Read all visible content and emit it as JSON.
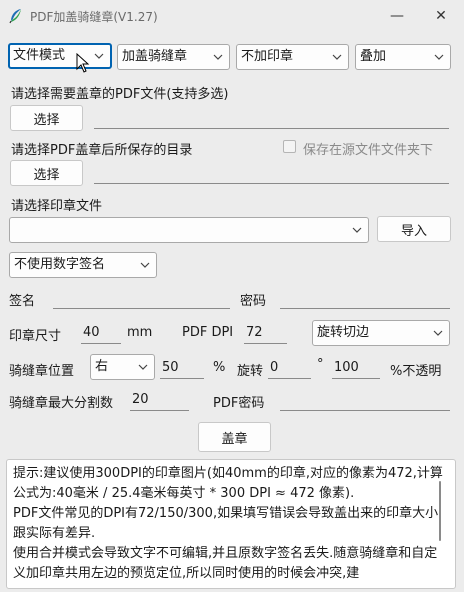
{
  "window": {
    "title": "PDF加盖骑缝章(V1.27)",
    "minimize": "—",
    "close": "✕",
    "app_icon": "feather-icon"
  },
  "toolbar": {
    "mode": "文件模式",
    "stamp_type": "加盖骑缝章",
    "no_stamp": "不加印章",
    "overlay": "叠加"
  },
  "input_section": {
    "label": "请选择需要盖章的PDF文件(支持多选)",
    "button": "选择",
    "value": ""
  },
  "output_section": {
    "label": "请选择PDF盖章后所保存的目录",
    "button": "选择",
    "value": "",
    "save_source_label": "保存在源文件文件夹下"
  },
  "stamp_file": {
    "label": "请选择印章文件",
    "value": "",
    "import_button": "导入"
  },
  "signature": {
    "select": "不使用数字签名",
    "name_label": "签名",
    "name_value": "",
    "password_label": "密码",
    "password_value": ""
  },
  "stamp_size": {
    "label": "印章尺寸",
    "value": "40",
    "unit": "mm",
    "dpi_label": "PDF DPI",
    "dpi_value": "72",
    "rotate_mode": "旋转切边"
  },
  "seam_position": {
    "label": "骑缝章位置",
    "side": "右",
    "percent": "50",
    "percent_unit": "%",
    "rotate_label": "旋转",
    "rotate_value": "0",
    "degree": "°",
    "opacity": "100",
    "opacity_label": "%不透明"
  },
  "max_split": {
    "label": "骑缝章最大分割数",
    "value": "20",
    "pdf_password_label": "PDF密码",
    "pdf_password_value": ""
  },
  "stamp_button": "盖章",
  "tips": [
    "提示:建议使用300DPI的印章图片(如40mm的印章,对应的像素为472,计算公式为:40毫米 / 25.4毫米每英寸 * 300 DPI ≈ 472 像素).",
    "PDF文件常见的DPI有72/150/300,如果填写错误会导致盖出来的印章大小跟实际有差异.",
    "使用合并模式会导致文字不可编辑,并且原数字签名丢失.随意骑缝章和自定义加印章共用左边的预览定位,所以同时使用的时候会冲突,建"
  ]
}
